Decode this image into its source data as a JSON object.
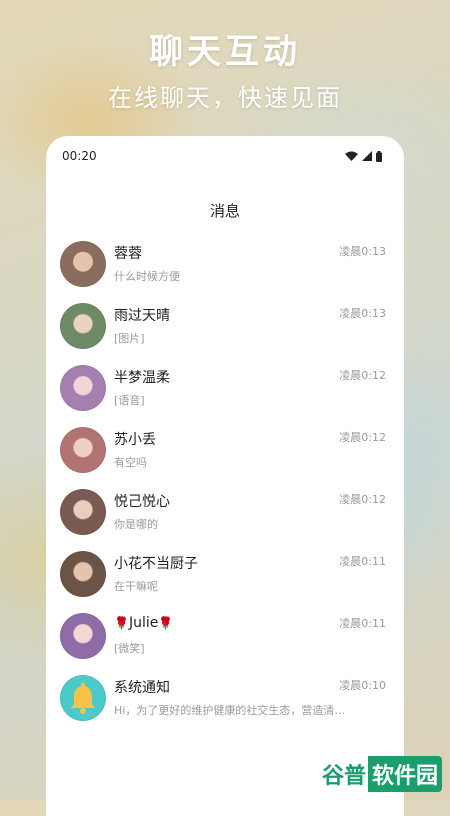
{
  "hero": {
    "title": "聊天互动",
    "subtitle": "在线聊天，快速见面"
  },
  "status_bar": {
    "time": "00:20",
    "icons": [
      "wifi-icon",
      "cellular-signal-icon",
      "battery-icon"
    ]
  },
  "page": {
    "title": "消息"
  },
  "chats": [
    {
      "name": "蓉蓉",
      "preview": "什么时候方便",
      "time": "凌晨0:13",
      "avatar_color": "#8a6d5e"
    },
    {
      "name": "雨过天晴",
      "preview": "[图片]",
      "time": "凌晨0:13",
      "avatar_color": "#6f8a67"
    },
    {
      "name": "半梦温柔",
      "preview": "[语音]",
      "time": "凌晨0:12",
      "avatar_color": "#a57fb0"
    },
    {
      "name": "苏小丢",
      "preview": "有空吗",
      "time": "凌晨0:12",
      "avatar_color": "#b27373"
    },
    {
      "name": "悦己悦心",
      "preview": "你是哪的",
      "time": "凌晨0:12",
      "avatar_color": "#7a5a52"
    },
    {
      "name": "小花不当厨子",
      "preview": "在干嘛呢",
      "time": "凌晨0:11",
      "avatar_color": "#6b5445"
    },
    {
      "name_prefix": "🌹",
      "name": "Julie",
      "name_suffix": "🌹",
      "preview": "[微笑]",
      "time": "凌晨0:11",
      "avatar_color": "#8f6ba8"
    },
    {
      "name": "系统通知",
      "preview": "Hi，为了更好的维护健康的社交生态，营造清朗...",
      "time": "凌晨0:10",
      "avatar_color": "#4cc9c9",
      "icon": "bell-icon",
      "icon_color": "#f5c24a"
    }
  ],
  "watermark": {
    "part1": "谷普",
    "part2": "软件园"
  },
  "colors": {
    "accent_bell": "#f5c24a",
    "system_avatar_bg": "#4cc9c9",
    "watermark_green": "#1a9e6b"
  }
}
